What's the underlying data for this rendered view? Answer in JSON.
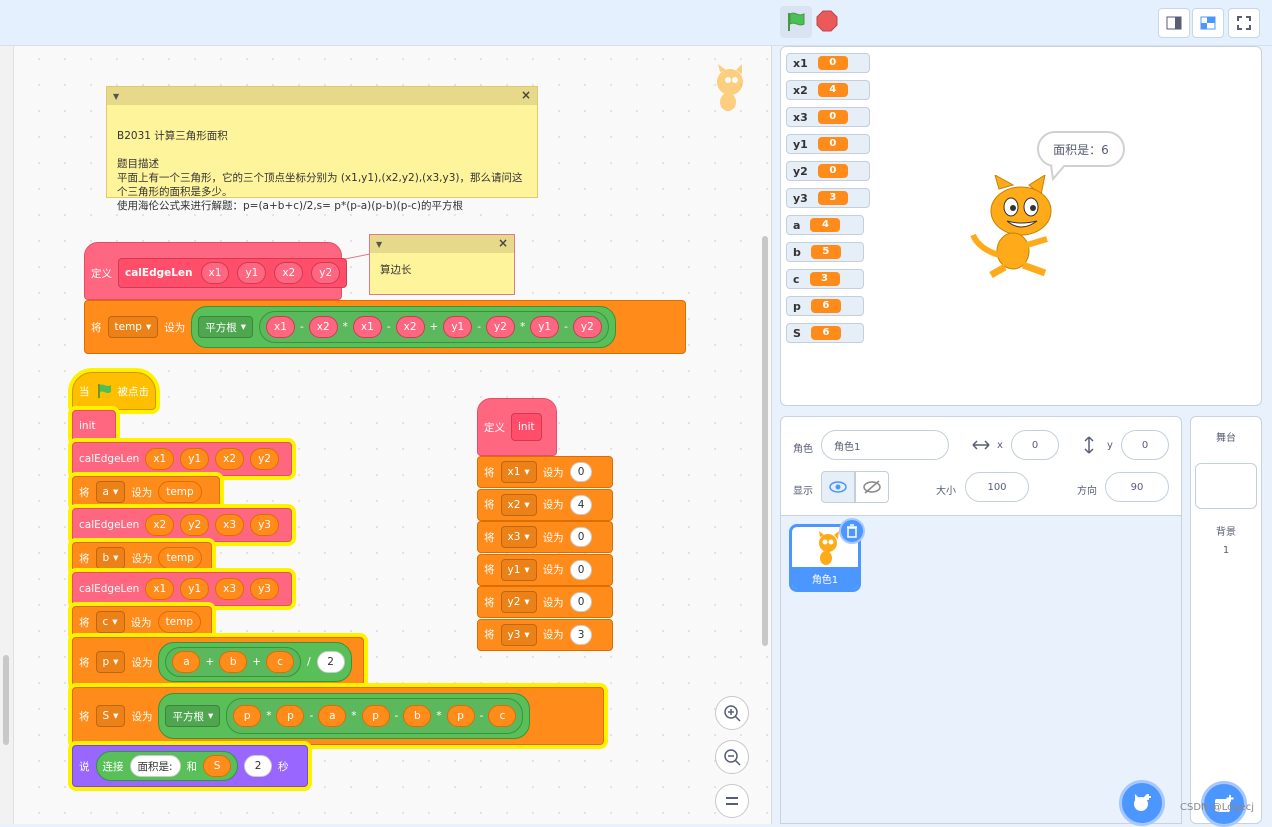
{
  "topbar": {
    "green_flag": "green-flag",
    "stop": "stop-sign"
  },
  "comments": {
    "main": {
      "title": "B2031 计算三角形面积",
      "body": "题目描述\n平面上有一个三角形，它的三个顶点坐标分别为 (x1,y1),(x2,y2),(x3,y3)，那么请问这个三角形的面积是多少。\n使用海伦公式来进行解题：p=(a+b+c)/2,s= p*(p-a)(p-b)(p-c)的平方根"
    },
    "edge": {
      "body": "算边长"
    }
  },
  "def1": {
    "kw": "定义",
    "name": "calEdgeLen",
    "params": [
      "x1",
      "y1",
      "x2",
      "y2"
    ]
  },
  "set_temp": {
    "kw": "将",
    "var": "temp",
    "to": "设为",
    "fn": "平方根",
    "terms": [
      "x1",
      "-",
      "x2",
      "*",
      "x1",
      "-",
      "x2",
      "+",
      "y1",
      "-",
      "y2",
      "*",
      "y1",
      "-",
      "y2"
    ]
  },
  "main": {
    "hat": {
      "when": "当",
      "clicked": "被点击"
    },
    "init": "init",
    "calls": [
      {
        "name": "calEdgeLen",
        "args": [
          "x1",
          "y1",
          "x2",
          "y2"
        ]
      },
      {
        "name": "calEdgeLen",
        "args": [
          "x2",
          "y2",
          "x3",
          "y3"
        ]
      },
      {
        "name": "calEdgeLen",
        "args": [
          "x1",
          "y1",
          "x3",
          "y3"
        ]
      }
    ],
    "sets": [
      {
        "kw": "将",
        "var": "a",
        "to": "设为",
        "val": "temp"
      },
      {
        "kw": "将",
        "var": "b",
        "to": "设为",
        "val": "temp"
      },
      {
        "kw": "将",
        "var": "c",
        "to": "设为",
        "val": "temp"
      }
    ],
    "set_p": {
      "kw": "将",
      "var": "p",
      "to": "设为",
      "a": "a",
      "plus": "+",
      "b": "b",
      "c": "c",
      "div": "/",
      "n": "2"
    },
    "set_s": {
      "kw": "将",
      "var": "S",
      "to": "设为",
      "fn": "平方根",
      "terms": [
        "p",
        "*",
        "p",
        "-",
        "a",
        "*",
        "p",
        "-",
        "b",
        "*",
        "p",
        "-",
        "c"
      ]
    },
    "say": {
      "kw": "说",
      "join": "连接",
      "text": "面积是:",
      "and": "和",
      "var": "S",
      "secs": "2",
      "sec": "秒"
    }
  },
  "def_init": {
    "kw": "定义",
    "name": "init",
    "sets": [
      {
        "kw": "将",
        "var": "x1",
        "to": "设为",
        "val": "0"
      },
      {
        "kw": "将",
        "var": "x2",
        "to": "设为",
        "val": "4"
      },
      {
        "kw": "将",
        "var": "x3",
        "to": "设为",
        "val": "0"
      },
      {
        "kw": "将",
        "var": "y1",
        "to": "设为",
        "val": "0"
      },
      {
        "kw": "将",
        "var": "y2",
        "to": "设为",
        "val": "0"
      },
      {
        "kw": "将",
        "var": "y3",
        "to": "设为",
        "val": "3"
      }
    ]
  },
  "monitors": [
    {
      "name": "x1",
      "val": "0"
    },
    {
      "name": "x2",
      "val": "4"
    },
    {
      "name": "x3",
      "val": "0"
    },
    {
      "name": "y1",
      "val": "0"
    },
    {
      "name": "y2",
      "val": "0"
    },
    {
      "name": "y3",
      "val": "3"
    },
    {
      "name": "a",
      "val": "4"
    },
    {
      "name": "b",
      "val": "5"
    },
    {
      "name": "c",
      "val": "3"
    },
    {
      "name": "p",
      "val": "6"
    },
    {
      "name": "S",
      "val": "6"
    }
  ],
  "bubble": "面积是：6",
  "sprite_info": {
    "sprite_label": "角色",
    "sprite_name": "角色1",
    "x_label": "x",
    "x_val": "0",
    "y_label": "y",
    "y_val": "0",
    "show_label": "显示",
    "size_label": "大小",
    "size_val": "100",
    "dir_label": "方向",
    "dir_val": "90"
  },
  "sprite_tile": {
    "name": "角色1"
  },
  "stage_panel": {
    "title": "舞台",
    "backdrop_label": "背景",
    "backdrop_count": "1"
  },
  "watermark": "CSDN @Logecj"
}
